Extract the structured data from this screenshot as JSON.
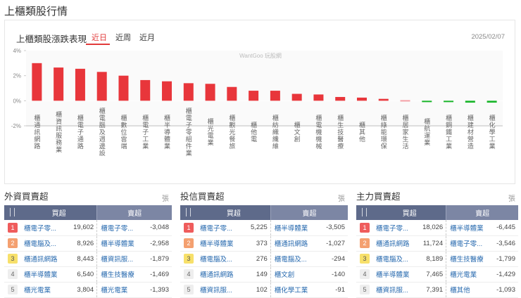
{
  "page_title": "上櫃類股行情",
  "chart_card": {
    "title": "上櫃類股漲跌表現",
    "tabs": [
      "近日",
      "近周",
      "近月"
    ],
    "active_tab": "近日",
    "date": "2025/02/07",
    "watermark": "WantGoo 玩股網"
  },
  "colors": {
    "up": "#e8363b",
    "up_light": "#f5a0a6",
    "down": "#1ab52a",
    "accent": "#e23b3b"
  },
  "chart_data": {
    "type": "bar",
    "title": "上櫃類股漲跌表現",
    "categories": [
      "櫃通訊網路",
      "櫃資訊服務業",
      "櫃電子通路",
      "櫃電腦及週邊設",
      "櫃數位雲端",
      "櫃電子工業",
      "櫃半導體業",
      "櫃電子零組件業",
      "櫃光電業",
      "櫃觀光餐旅",
      "櫃他電",
      "櫃紡織纖維",
      "櫃文創",
      "櫃電機機械",
      "櫃生技醫療",
      "櫃其他",
      "櫃綠能環保",
      "櫃居家生活",
      "櫃航運業",
      "櫃鋼鐵工業",
      "櫃建材營造",
      "櫃化學工業"
    ],
    "values": [
      3.0,
      2.65,
      2.55,
      2.3,
      2.0,
      1.65,
      1.55,
      1.4,
      1.35,
      1.1,
      0.8,
      0.8,
      0.55,
      0.5,
      0.3,
      0.25,
      0.15,
      0.05,
      -0.05,
      -0.1,
      -0.15,
      -0.15
    ],
    "yticks": [
      "4%",
      "2%",
      "0%",
      "-2%"
    ],
    "ylim": [
      -2,
      4
    ],
    "unit": "%"
  },
  "panels": [
    {
      "title": "外資買賣超",
      "unit": "張",
      "buy_header": "買超",
      "sell_header": "賣超",
      "rows": [
        {
          "rank": "1",
          "buy": "櫃電子零...",
          "buy_val": "19,602",
          "sell": "櫃電子零...",
          "sell_val": "-3,048"
        },
        {
          "rank": "2",
          "buy": "櫃電腦及...",
          "buy_val": "8,926",
          "sell": "櫃半導體業",
          "sell_val": "-2,958"
        },
        {
          "rank": "3",
          "buy": "櫃通訊網路",
          "buy_val": "8,443",
          "sell": "櫃資訊服...",
          "sell_val": "-1,879"
        },
        {
          "rank": "4",
          "buy": "櫃半導體業",
          "buy_val": "6,540",
          "sell": "櫃生技醫療",
          "sell_val": "-1,469"
        },
        {
          "rank": "5",
          "buy": "櫃光電業",
          "buy_val": "3,804",
          "sell": "櫃光電業",
          "sell_val": "-1,393"
        }
      ]
    },
    {
      "title": "投信買賣超",
      "unit": "張",
      "buy_header": "買超",
      "sell_header": "賣超",
      "rows": [
        {
          "rank": "1",
          "buy": "櫃電子零...",
          "buy_val": "5,225",
          "sell": "櫃半導體業",
          "sell_val": "-3,505"
        },
        {
          "rank": "2",
          "buy": "櫃半導體業",
          "buy_val": "373",
          "sell": "櫃通訊網路",
          "sell_val": "-1,027"
        },
        {
          "rank": "3",
          "buy": "櫃電腦及...",
          "buy_val": "276",
          "sell": "櫃電腦及...",
          "sell_val": "-294"
        },
        {
          "rank": "4",
          "buy": "櫃通訊網路",
          "buy_val": "149",
          "sell": "櫃文創",
          "sell_val": "-140"
        },
        {
          "rank": "5",
          "buy": "櫃資訊服...",
          "buy_val": "102",
          "sell": "櫃化學工業",
          "sell_val": "-91"
        }
      ]
    },
    {
      "title": "主力買賣超",
      "unit": "張",
      "buy_header": "買超",
      "sell_header": "賣超",
      "rows": [
        {
          "rank": "1",
          "buy": "櫃電子零...",
          "buy_val": "18,026",
          "sell": "櫃半導體業",
          "sell_val": "-6,445"
        },
        {
          "rank": "2",
          "buy": "櫃通訊網路",
          "buy_val": "11,724",
          "sell": "櫃電子零...",
          "sell_val": "-3,546"
        },
        {
          "rank": "3",
          "buy": "櫃電腦及...",
          "buy_val": "8,189",
          "sell": "櫃生技醫療",
          "sell_val": "-1,799"
        },
        {
          "rank": "4",
          "buy": "櫃半導體業",
          "buy_val": "7,465",
          "sell": "櫃光電業",
          "sell_val": "-1,429"
        },
        {
          "rank": "5",
          "buy": "櫃資訊服...",
          "buy_val": "7,391",
          "sell": "櫃其他",
          "sell_val": "-1,093"
        }
      ]
    }
  ]
}
